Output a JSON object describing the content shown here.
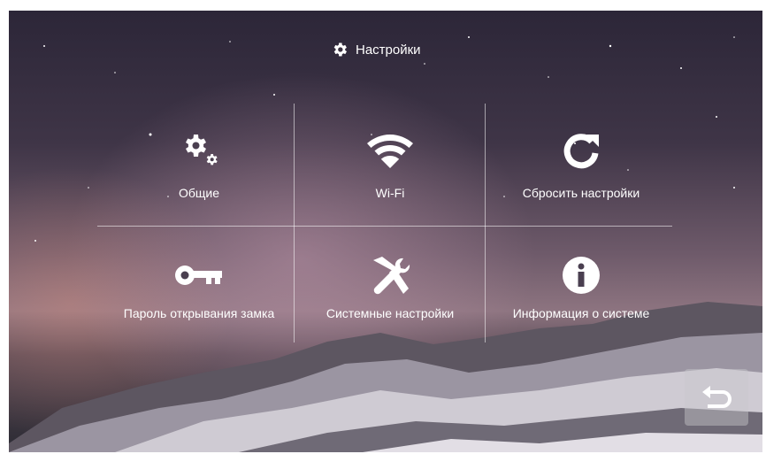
{
  "header": {
    "title": "Настройки",
    "icon": "gear-icon"
  },
  "menu": [
    {
      "label": "Общие",
      "icon": "gears-icon"
    },
    {
      "label": "Wi-Fi",
      "icon": "wifi-icon"
    },
    {
      "label": "Сбросить настройки",
      "icon": "reset-icon"
    },
    {
      "label": "Пароль открывания замка",
      "icon": "key-icon"
    },
    {
      "label": "Системные настройки",
      "icon": "tools-icon"
    },
    {
      "label": "Информация о системе",
      "icon": "info-icon"
    }
  ],
  "footer": {
    "back_icon": "back-arrow-icon"
  },
  "colors": {
    "text": "#ffffff",
    "button_bg": "#c8c8cd"
  }
}
